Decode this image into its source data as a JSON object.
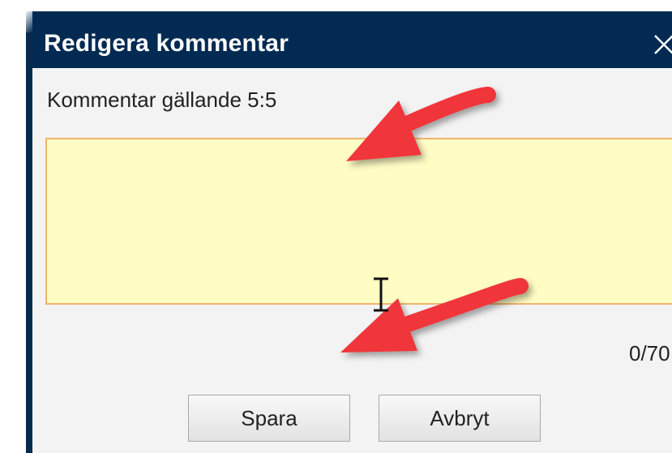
{
  "dialog": {
    "title": "Redigera kommentar",
    "close_icon": "close-icon",
    "comment_label": "Kommentar gällande 5:5",
    "comment_value": "",
    "counter": "0/70",
    "save_label": "Spara",
    "cancel_label": "Avbryt"
  },
  "annotations": {
    "arrow_color": "#f0353a",
    "arrow_count": 2
  },
  "colors": {
    "titlebar": "#022a52",
    "body": "#f3f3f3",
    "textarea_bg": "#fffcc4",
    "textarea_border": "#f1b46b"
  }
}
